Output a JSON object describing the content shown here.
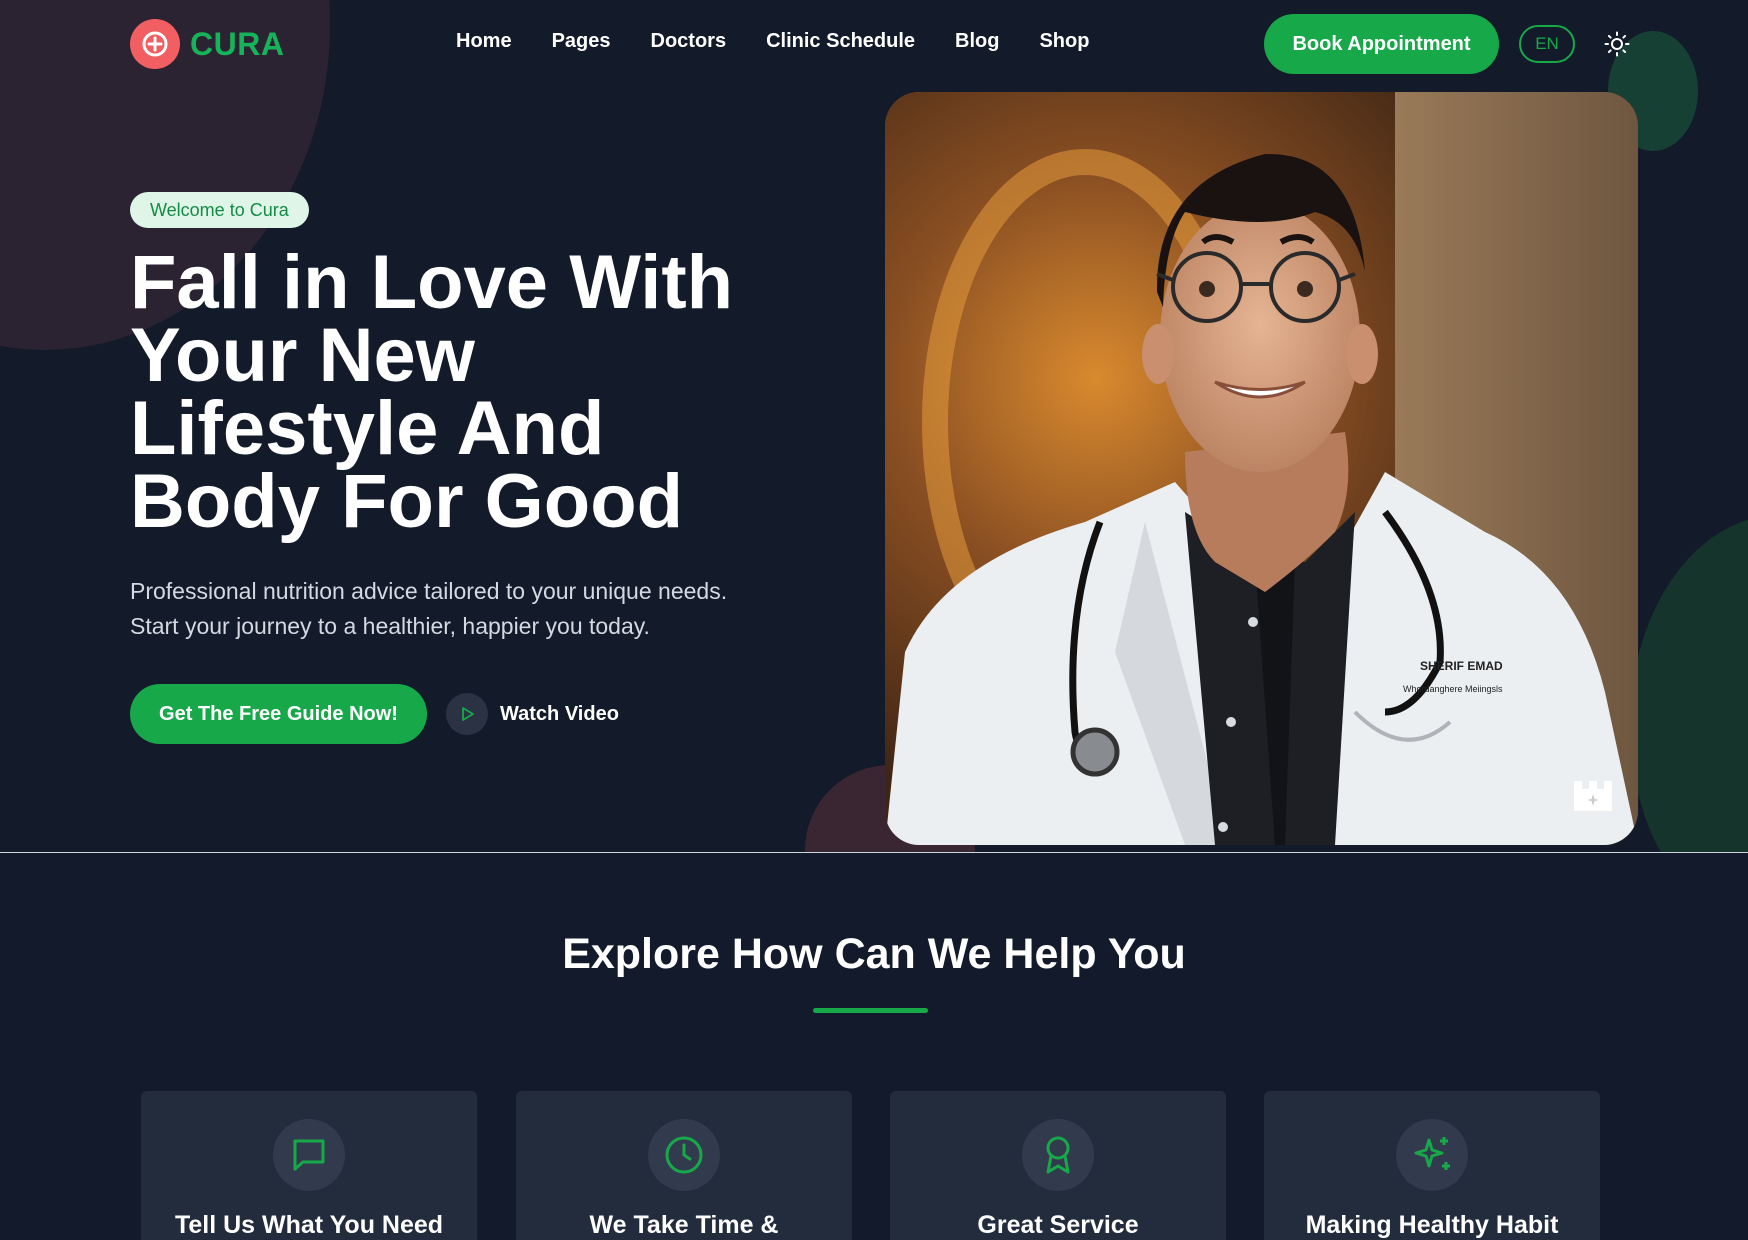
{
  "brand": {
    "name": "CURA",
    "accent": "#17a84a",
    "logo_color": "#f15f63"
  },
  "nav": {
    "items": [
      "Home",
      "Pages",
      "Doctors",
      "Clinic Schedule",
      "Blog",
      "Shop"
    ],
    "book_label": "Book Appointment",
    "lang_label": "EN",
    "theme_icon": "sun-icon"
  },
  "hero": {
    "badge": "Welcome to Cura",
    "title": "Fall in Love With Your New Lifestyle And Body For Good",
    "description": "Professional nutrition advice tailored to your unique needs. Start your journey to a healthier, happier you today.",
    "cta_label": "Get The Free Guide Now!",
    "video_label": "Watch Video",
    "photo": {
      "icon": "doctor-portrait-photo",
      "coat_text_1": "SHERIF EMAD",
      "coat_text_2": "Whordanghere Meiingsls"
    }
  },
  "services": {
    "title": "Explore How Can We Help You",
    "cards": [
      {
        "title": "Tell Us What You Need",
        "icon": "message-icon"
      },
      {
        "title": "We Take Time &",
        "icon": "clock-icon"
      },
      {
        "title": "Great Service",
        "icon": "award-icon"
      },
      {
        "title": "Making Healthy Habit",
        "icon": "sparkles-icon"
      }
    ]
  }
}
